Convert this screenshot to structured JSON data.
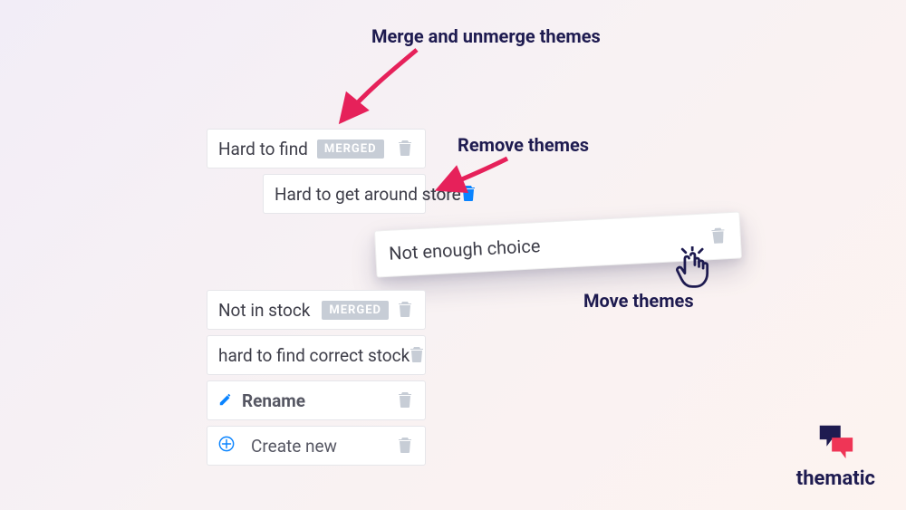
{
  "annotations": {
    "merge": "Merge and unmerge themes",
    "remove": "Remove themes",
    "move": "Move themes"
  },
  "rows": {
    "r1": {
      "label": "Hard to find",
      "merged_badge": "MERGED"
    },
    "r2": {
      "label": "Hard to get around store"
    },
    "r3_drag": {
      "label": "Not enough choice"
    },
    "r4": {
      "label": "Not in stock",
      "merged_badge": "MERGED"
    },
    "r5": {
      "label": "hard to find correct stock"
    },
    "rename": {
      "label": "Rename"
    },
    "create": {
      "label": "Create new"
    }
  },
  "brand": {
    "name": "thematic"
  },
  "colors": {
    "navy": "#1e1b50",
    "pink": "#e6215a",
    "blue": "#0a84ff",
    "trash_muted": "#c7cdd6"
  }
}
